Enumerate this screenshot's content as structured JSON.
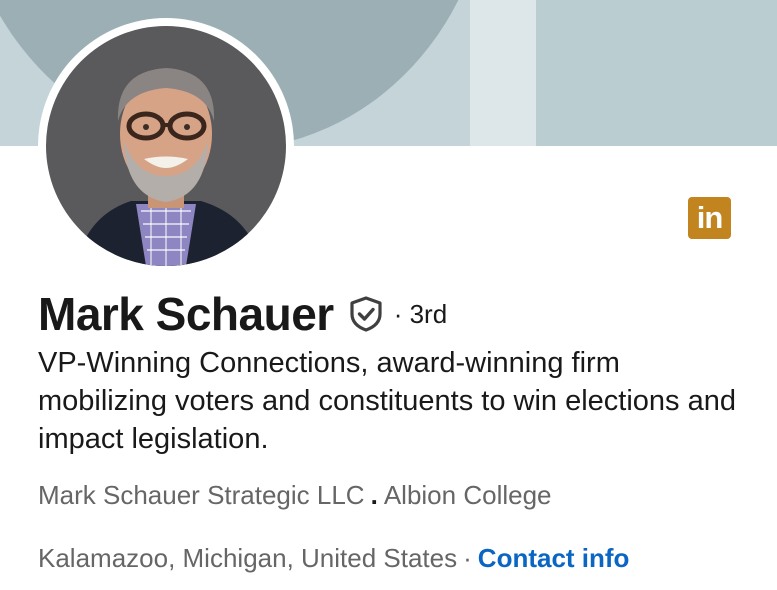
{
  "profile": {
    "name": "Mark Schauer",
    "degree": "· 3rd",
    "headline": "VP-Winning Connections, award-winning firm mobilizing voters and constituents to win elections and impact legislation.",
    "company": "Mark Schauer Strategic LLC",
    "company_separator": ".",
    "school": "Albion College",
    "location": "Kalamazoo, Michigan, United States",
    "location_separator": "·",
    "contact_label": "Contact info"
  },
  "brand": {
    "logo_text": "in",
    "logo_color": "#c2841e",
    "link_color": "#0a66c2"
  },
  "icons": {
    "verified": "verified-shield-icon",
    "logo": "linkedin-logo-icon"
  }
}
